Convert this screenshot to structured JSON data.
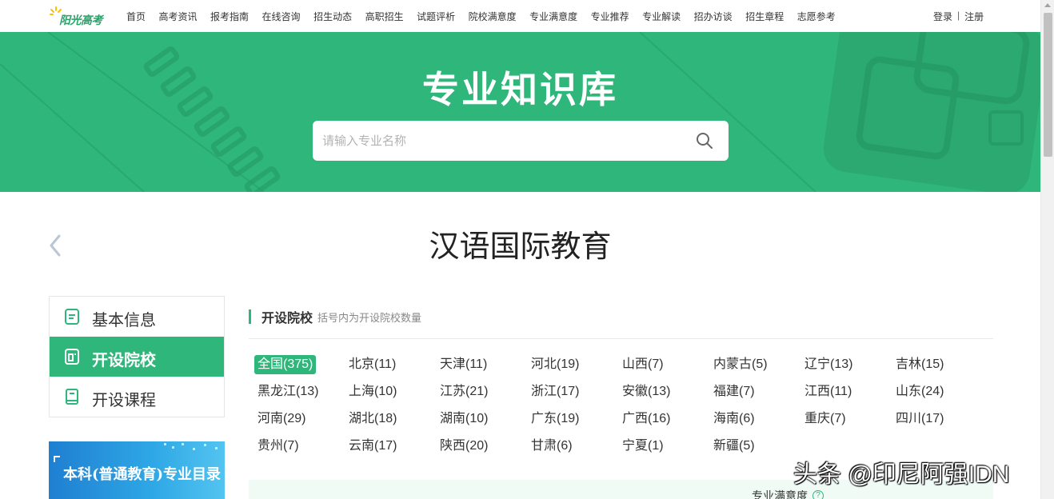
{
  "logo": {
    "text": "阳光高考"
  },
  "nav": {
    "items": [
      "首页",
      "高考资讯",
      "报考指南",
      "在线咨询",
      "招生动态",
      "高职招生",
      "试题评析",
      "院校满意度",
      "专业满意度",
      "专业推荐",
      "专业解读",
      "招办访谈",
      "招生章程",
      "志愿参考"
    ],
    "login": "登录",
    "separator": "|",
    "register": "注册"
  },
  "banner": {
    "title": "专业知识库",
    "search_placeholder": "请输入专业名称"
  },
  "major": {
    "title": "汉语国际教育"
  },
  "side_menu": [
    {
      "label": "基本信息",
      "icon": "document-icon",
      "active": false
    },
    {
      "label": "开设院校",
      "icon": "school-icon",
      "active": true
    },
    {
      "label": "开设课程",
      "icon": "book-icon",
      "active": false
    }
  ],
  "promo": {
    "text": "本科(普通教育)专业目录"
  },
  "section": {
    "title": "开设院校",
    "note": "括号内为开设院校数量"
  },
  "regions": [
    "全国(375)",
    "北京(11)",
    "天津(11)",
    "河北(19)",
    "山西(7)",
    "内蒙古(5)",
    "辽宁(13)",
    "吉林(15)",
    "黑龙江(13)",
    "上海(10)",
    "江苏(21)",
    "浙江(17)",
    "安徽(13)",
    "福建(7)",
    "江西(11)",
    "山东(24)",
    "河南(29)",
    "湖北(18)",
    "湖南(10)",
    "广东(19)",
    "广西(16)",
    "海南(6)",
    "重庆(7)",
    "四川(17)",
    "贵州(7)",
    "云南(17)",
    "陕西(20)",
    "甘肃(6)",
    "宁夏(1)",
    "新疆(5)"
  ],
  "active_region_index": 0,
  "satisfaction": {
    "label": "专业满意度",
    "help": "?"
  },
  "watermark": "头条 @印尼阿强IDN",
  "colors": {
    "accent": "#2fb67a",
    "banner": "#2fb67a"
  }
}
